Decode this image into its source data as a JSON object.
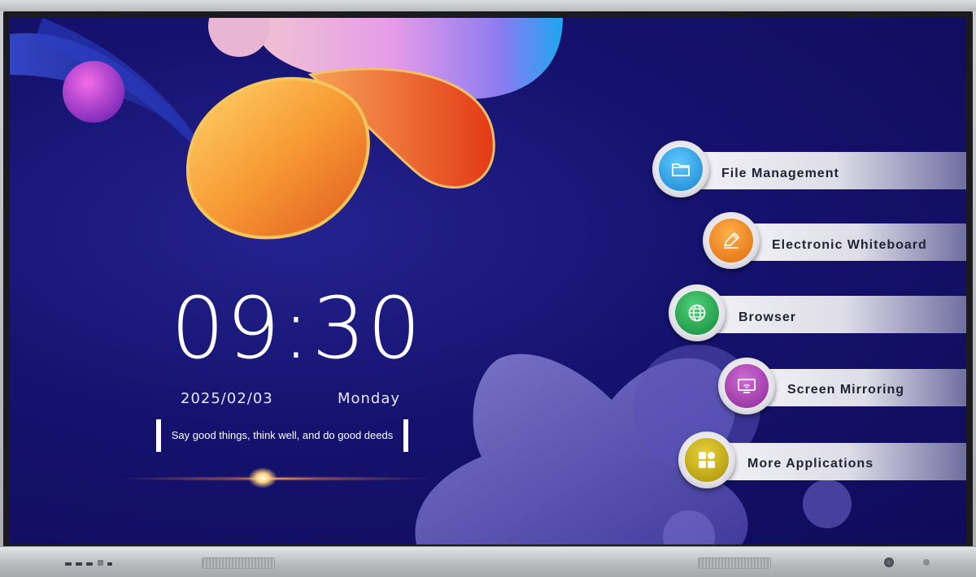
{
  "clock": {
    "time": "09:30",
    "date": "2025/02/03",
    "weekday": "Monday",
    "motto": "Say good things, think well, and do good deeds"
  },
  "apps": [
    {
      "label": "File Management",
      "icon": "folder-icon",
      "color": "#1fa1e0"
    },
    {
      "label": "Electronic Whiteboard",
      "icon": "pencil-icon",
      "color": "#ef7d12"
    },
    {
      "label": "Browser",
      "icon": "globe-icon",
      "color": "#1fa64a"
    },
    {
      "label": "Screen Mirroring",
      "icon": "screen-mirror-icon",
      "color": "#a23ba9"
    },
    {
      "label": "More Applications",
      "icon": "apps-grid-icon",
      "color": "#c3ab11"
    }
  ],
  "colors": {
    "background": "#15126e",
    "accent_orange": "#f08a2a",
    "accent_purple": "#b84fd9"
  }
}
